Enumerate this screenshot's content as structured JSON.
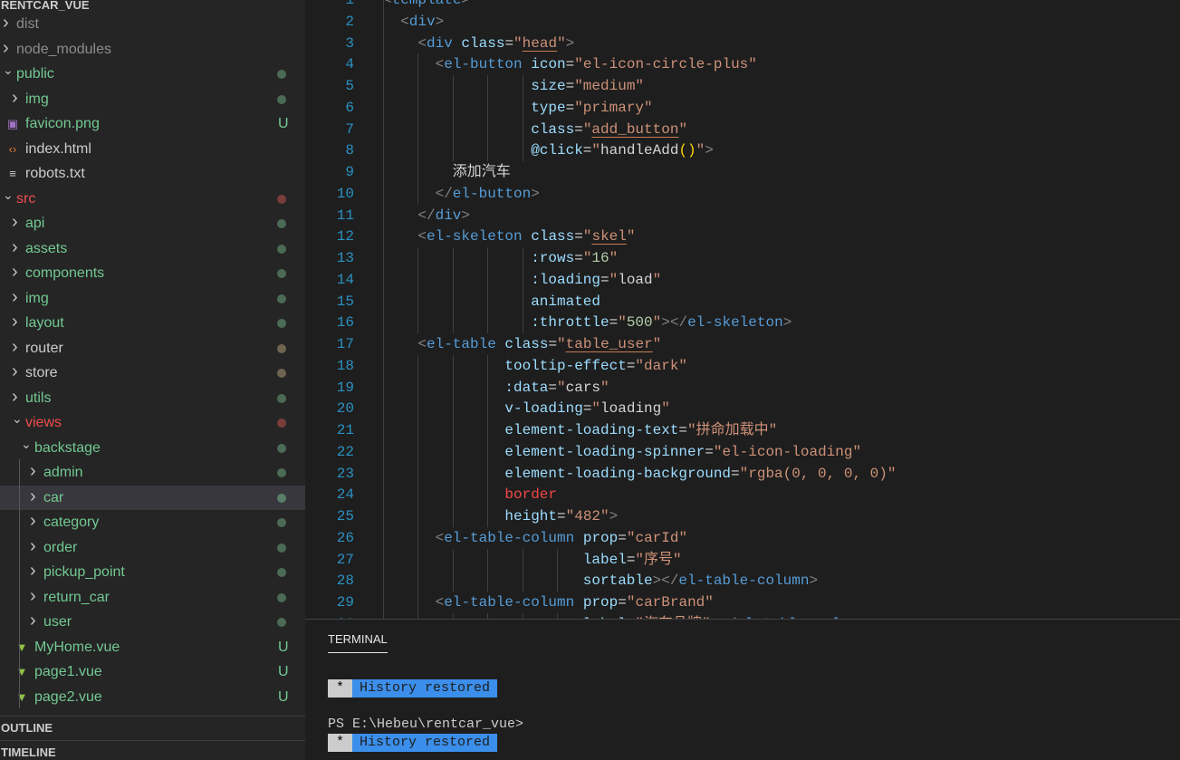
{
  "explorer": {
    "root_label": "RENTCAR_VUE",
    "items": [
      {
        "label": "dist",
        "level": 0,
        "kind": "folder",
        "open": false,
        "color": "#8c8c8c"
      },
      {
        "label": "node_modules",
        "level": 0,
        "kind": "folder",
        "open": false,
        "color": "#8c8c8c"
      },
      {
        "label": "public",
        "level": 0,
        "kind": "folder",
        "open": true,
        "color": "#73c991",
        "dot": "#4b6b55"
      },
      {
        "label": "img",
        "level": 1,
        "kind": "folder",
        "open": false,
        "color": "#73c991",
        "dot": "#4b6b55"
      },
      {
        "label": "favicon.png",
        "level": 1,
        "kind": "image",
        "color": "#73c991",
        "badge": "U"
      },
      {
        "label": "index.html",
        "level": 1,
        "kind": "html",
        "color": "#cccccc"
      },
      {
        "label": "robots.txt",
        "level": 1,
        "kind": "text",
        "color": "#cccccc"
      },
      {
        "label": "src",
        "level": 0,
        "kind": "folder",
        "open": true,
        "color": "#f14c4c",
        "dot": "#7a3e3a"
      },
      {
        "label": "api",
        "level": 1,
        "kind": "folder",
        "open": false,
        "color": "#73c991",
        "dot": "#4b6b55"
      },
      {
        "label": "assets",
        "level": 1,
        "kind": "folder",
        "open": false,
        "color": "#73c991",
        "dot": "#4b6b55"
      },
      {
        "label": "components",
        "level": 1,
        "kind": "folder",
        "open": false,
        "color": "#73c991",
        "dot": "#4b6b55"
      },
      {
        "label": "img",
        "level": 1,
        "kind": "folder",
        "open": false,
        "color": "#73c991",
        "dot": "#4b6b55"
      },
      {
        "label": "layout",
        "level": 1,
        "kind": "folder",
        "open": false,
        "color": "#73c991",
        "dot": "#4b6b55"
      },
      {
        "label": "router",
        "level": 1,
        "kind": "folder",
        "open": false,
        "color": "#cccccc",
        "dot": "#6e6450"
      },
      {
        "label": "store",
        "level": 1,
        "kind": "folder",
        "open": false,
        "color": "#cccccc",
        "dot": "#6e6450"
      },
      {
        "label": "utils",
        "level": 1,
        "kind": "folder",
        "open": false,
        "color": "#73c991",
        "dot": "#4b6b55"
      },
      {
        "label": "views",
        "level": 1,
        "kind": "folder",
        "open": true,
        "color": "#f14c4c",
        "dot": "#7a3e3a"
      },
      {
        "label": "backstage",
        "level": 2,
        "kind": "folder",
        "open": true,
        "color": "#73c991",
        "dot": "#4b6b55"
      },
      {
        "label": "admin",
        "level": 3,
        "kind": "folder",
        "open": false,
        "color": "#73c991",
        "dot": "#4b6b55"
      },
      {
        "label": "car",
        "level": 3,
        "kind": "folder",
        "open": false,
        "color": "#73c991",
        "dot": "#5a7f68",
        "selected": true
      },
      {
        "label": "category",
        "level": 3,
        "kind": "folder",
        "open": false,
        "color": "#73c991",
        "dot": "#4b6b55"
      },
      {
        "label": "order",
        "level": 3,
        "kind": "folder",
        "open": false,
        "color": "#73c991",
        "dot": "#4b6b55"
      },
      {
        "label": "pickup_point",
        "level": 3,
        "kind": "folder",
        "open": false,
        "color": "#73c991",
        "dot": "#4b6b55"
      },
      {
        "label": "return_car",
        "level": 3,
        "kind": "folder",
        "open": false,
        "color": "#73c991",
        "dot": "#4b6b55"
      },
      {
        "label": "user",
        "level": 3,
        "kind": "folder",
        "open": false,
        "color": "#73c991",
        "dot": "#4b6b55"
      },
      {
        "label": "MyHome.vue",
        "level": 2,
        "kind": "vue",
        "color": "#73c991",
        "badge": "U"
      },
      {
        "label": "page1.vue",
        "level": 2,
        "kind": "vue",
        "color": "#73c991",
        "badge": "U"
      },
      {
        "label": "page2.vue",
        "level": 2,
        "kind": "vue",
        "color": "#73c991",
        "badge": "U"
      }
    ],
    "outline_label": "OUTLINE",
    "timeline_label": "TIMELINE"
  },
  "editor": {
    "first_line": 1,
    "lines": [
      {
        "i": 0,
        "t": [
          [
            "b",
            "<"
          ],
          [
            "t",
            "template"
          ],
          [
            "b",
            ">"
          ]
        ]
      },
      {
        "i": 2,
        "t": [
          [
            "b",
            "<"
          ],
          [
            "t",
            "div"
          ],
          [
            "b",
            ">"
          ]
        ]
      },
      {
        "i": 4,
        "t": [
          [
            "b",
            "<"
          ],
          [
            "t",
            "div"
          ],
          [
            "x",
            " "
          ],
          [
            "a",
            "class"
          ],
          [
            "x",
            "="
          ],
          [
            "s",
            "\""
          ],
          [
            "u",
            "head"
          ],
          [
            "s",
            "\""
          ],
          [
            "b",
            ">"
          ]
        ]
      },
      {
        "i": 6,
        "t": [
          [
            "b",
            "<"
          ],
          [
            "t",
            "el-button"
          ],
          [
            "x",
            " "
          ],
          [
            "a",
            "icon"
          ],
          [
            "x",
            "="
          ],
          [
            "s",
            "\"el-icon-circle-plus\""
          ]
        ]
      },
      {
        "i": 17,
        "t": [
          [
            "a",
            "size"
          ],
          [
            "x",
            "="
          ],
          [
            "s",
            "\"medium\""
          ]
        ]
      },
      {
        "i": 17,
        "t": [
          [
            "a",
            "type"
          ],
          [
            "x",
            "="
          ],
          [
            "s",
            "\"primary\""
          ]
        ]
      },
      {
        "i": 17,
        "t": [
          [
            "a",
            "class"
          ],
          [
            "x",
            "="
          ],
          [
            "s",
            "\""
          ],
          [
            "u",
            "add_button"
          ],
          [
            "s",
            "\""
          ]
        ]
      },
      {
        "i": 17,
        "t": [
          [
            "a",
            "@click"
          ],
          [
            "x",
            "="
          ],
          [
            "s",
            "\""
          ],
          [
            "x",
            "handleAdd"
          ],
          [
            "y",
            "()"
          ],
          [
            "s",
            "\""
          ],
          [
            "b",
            ">"
          ]
        ]
      },
      {
        "i": 8,
        "t": [
          [
            "x",
            "添加汽车"
          ]
        ]
      },
      {
        "i": 6,
        "t": [
          [
            "b",
            "</"
          ],
          [
            "t",
            "el-button"
          ],
          [
            "b",
            ">"
          ]
        ]
      },
      {
        "i": 4,
        "t": [
          [
            "b",
            "</"
          ],
          [
            "t",
            "div"
          ],
          [
            "b",
            ">"
          ]
        ]
      },
      {
        "i": 4,
        "t": [
          [
            "b",
            "<"
          ],
          [
            "t",
            "el-skeleton"
          ],
          [
            "x",
            " "
          ],
          [
            "a",
            "class"
          ],
          [
            "x",
            "="
          ],
          [
            "s",
            "\""
          ],
          [
            "u",
            "skel"
          ],
          [
            "s",
            "\""
          ]
        ]
      },
      {
        "i": 17,
        "t": [
          [
            "a",
            ":rows"
          ],
          [
            "x",
            "="
          ],
          [
            "s",
            "\""
          ],
          [
            "n",
            "16"
          ],
          [
            "s",
            "\""
          ]
        ]
      },
      {
        "i": 17,
        "t": [
          [
            "a",
            ":loading"
          ],
          [
            "x",
            "="
          ],
          [
            "s",
            "\""
          ],
          [
            "x",
            "load"
          ],
          [
            "s",
            "\""
          ]
        ]
      },
      {
        "i": 17,
        "t": [
          [
            "a",
            "animated"
          ]
        ]
      },
      {
        "i": 17,
        "t": [
          [
            "a",
            ":throttle"
          ],
          [
            "x",
            "="
          ],
          [
            "s",
            "\""
          ],
          [
            "n",
            "500"
          ],
          [
            "s",
            "\""
          ],
          [
            "b",
            "></"
          ],
          [
            "t",
            "el-skeleton"
          ],
          [
            "b",
            ">"
          ]
        ]
      },
      {
        "i": 4,
        "t": [
          [
            "b",
            "<"
          ],
          [
            "t",
            "el-table"
          ],
          [
            "x",
            " "
          ],
          [
            "a",
            "class"
          ],
          [
            "x",
            "="
          ],
          [
            "s",
            "\""
          ],
          [
            "u",
            "table_user"
          ],
          [
            "s",
            "\""
          ]
        ]
      },
      {
        "i": 14,
        "t": [
          [
            "a",
            "tooltip-effect"
          ],
          [
            "x",
            "="
          ],
          [
            "s",
            "\"dark\""
          ]
        ]
      },
      {
        "i": 14,
        "t": [
          [
            "a",
            ":data"
          ],
          [
            "x",
            "="
          ],
          [
            "s",
            "\""
          ],
          [
            "x",
            "cars"
          ],
          [
            "s",
            "\""
          ]
        ]
      },
      {
        "i": 14,
        "t": [
          [
            "a",
            "v-loading"
          ],
          [
            "x",
            "="
          ],
          [
            "s",
            "\""
          ],
          [
            "x",
            "loading"
          ],
          [
            "s",
            "\""
          ]
        ]
      },
      {
        "i": 14,
        "t": [
          [
            "a",
            "element-loading-text"
          ],
          [
            "x",
            "="
          ],
          [
            "s",
            "\"拼命加载中\""
          ]
        ]
      },
      {
        "i": 14,
        "t": [
          [
            "a",
            "element-loading-spinner"
          ],
          [
            "x",
            "="
          ],
          [
            "s",
            "\"el-icon-loading\""
          ]
        ]
      },
      {
        "i": 14,
        "t": [
          [
            "a",
            "element-loading-background"
          ],
          [
            "x",
            "="
          ],
          [
            "s",
            "\"rgba(0, 0, 0, 0)\""
          ]
        ]
      },
      {
        "i": 14,
        "t": [
          [
            "e",
            "border"
          ]
        ]
      },
      {
        "i": 14,
        "t": [
          [
            "a",
            "height"
          ],
          [
            "x",
            "="
          ],
          [
            "s",
            "\"482\""
          ],
          [
            "b",
            ">"
          ]
        ]
      },
      {
        "i": 6,
        "t": [
          [
            "b",
            "<"
          ],
          [
            "t",
            "el-table-column"
          ],
          [
            "x",
            " "
          ],
          [
            "a",
            "prop"
          ],
          [
            "x",
            "="
          ],
          [
            "s",
            "\"carId\""
          ]
        ]
      },
      {
        "i": 23,
        "t": [
          [
            "a",
            "label"
          ],
          [
            "x",
            "="
          ],
          [
            "s",
            "\"序号\""
          ]
        ]
      },
      {
        "i": 23,
        "t": [
          [
            "a",
            "sortable"
          ],
          [
            "b",
            "></"
          ],
          [
            "t",
            "el-table-column"
          ],
          [
            "b",
            ">"
          ]
        ]
      },
      {
        "i": 6,
        "t": [
          [
            "b",
            "<"
          ],
          [
            "t",
            "el-table-column"
          ],
          [
            "x",
            " "
          ],
          [
            "a",
            "prop"
          ],
          [
            "x",
            "="
          ],
          [
            "s",
            "\"carBrand\""
          ]
        ]
      },
      {
        "i": 23,
        "t": [
          [
            "a",
            "label"
          ],
          [
            "x",
            "="
          ],
          [
            "s",
            "\"汽车品牌\""
          ],
          [
            "b",
            "></"
          ],
          [
            "t",
            "el-table-column"
          ],
          [
            "b",
            ">"
          ]
        ]
      }
    ]
  },
  "panel": {
    "tab_label": "TERMINAL",
    "history_star": "*",
    "history_text": "History restored",
    "prompt": "PS E:\\Hebeu\\rentcar_vue>"
  }
}
